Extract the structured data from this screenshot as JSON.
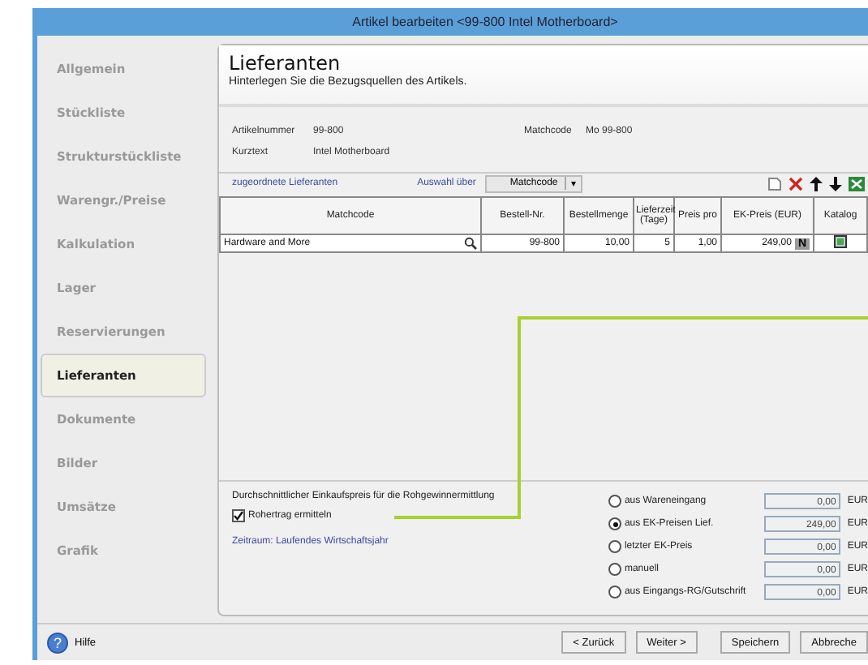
{
  "window": {
    "title": "Artikel bearbeiten <99-800 Intel Motherboard>"
  },
  "sidebar": {
    "items": [
      {
        "label": "Allgemein",
        "selected": false
      },
      {
        "label": "Stückliste",
        "selected": false
      },
      {
        "label": "Strukturstückliste",
        "selected": false
      },
      {
        "label": "Warengr./Preise",
        "selected": false
      },
      {
        "label": "Kalkulation",
        "selected": false
      },
      {
        "label": "Lager",
        "selected": false
      },
      {
        "label": "Reservierungen",
        "selected": false
      },
      {
        "label": "Lieferanten",
        "selected": true
      },
      {
        "label": "Dokumente",
        "selected": false
      },
      {
        "label": "Bilder",
        "selected": false
      },
      {
        "label": "Umsätze",
        "selected": false
      },
      {
        "label": "Grafik",
        "selected": false
      }
    ]
  },
  "header": {
    "title": "Lieferanten",
    "subtitle": "Hinterlegen Sie die Bezugsquellen des Artikels."
  },
  "info": [
    {
      "label": "Artikelnummer",
      "value": "99-800"
    },
    {
      "label": "Kurztext",
      "value": "Intel Motherboard"
    }
  ],
  "matchcode": {
    "label": "Matchcode",
    "value": "Mo 99-800"
  },
  "toolbar": {
    "title": "zugeordnete Lieferanten",
    "selector_label": "Auswahl über",
    "selector_value": "Matchcode",
    "caret": "▾"
  },
  "table": {
    "columns": [
      "Matchcode",
      "Bestell-Nr.",
      "Bestellmenge",
      "Lieferzeit (Tage)",
      "Preis pro",
      "EK-Preis (EUR)",
      "Katalog"
    ],
    "rows": [
      {
        "matchcode": "Hardware and More",
        "order_no": "99-800",
        "quantity": "10,00",
        "lead_time": "5",
        "price_per": "1,00",
        "price": "249,00",
        "price_flag": "N"
      }
    ]
  },
  "average": {
    "title": "Durchschnittlicher Einkaufspreis für die Rohgewinnermittlung",
    "checkbox": {
      "label": "Rohertrag ermitteln",
      "checked": true
    },
    "period": "Zeitraum: Laufendes Wirtschaftsjahr",
    "options": [
      {
        "label": "aus Wareneingang",
        "value": "0,00",
        "currency": "EUR",
        "selected": false
      },
      {
        "label": "aus EK-Preisen Lief.",
        "value": "249,00",
        "currency": "EUR",
        "selected": true
      },
      {
        "label": "letzter EK-Preis",
        "value": "0,00",
        "currency": "EUR",
        "selected": false
      },
      {
        "label": "manuell",
        "value": "0,00",
        "currency": "EUR",
        "selected": false
      },
      {
        "label": "aus Eingangs-RG/Gutschrift",
        "value": "0,00",
        "currency": "EUR",
        "selected": false
      }
    ]
  },
  "footer": {
    "help_icon": "?",
    "help": "Hilfe",
    "buttons": [
      "< Zurück",
      "Weiter >",
      "Speichern",
      "Abbreche"
    ]
  }
}
